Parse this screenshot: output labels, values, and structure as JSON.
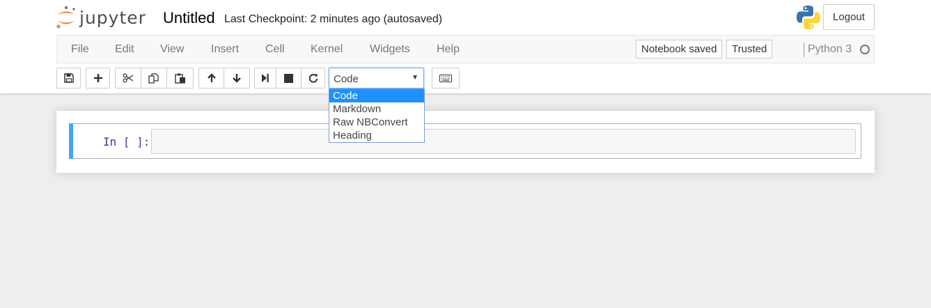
{
  "header": {
    "logo_text": "jupyter",
    "notebook_name": "Untitled",
    "checkpoint": "Last Checkpoint: 2 minutes ago (autosaved)",
    "logout_label": "Logout"
  },
  "menubar": {
    "items": [
      "File",
      "Edit",
      "View",
      "Insert",
      "Cell",
      "Kernel",
      "Widgets",
      "Help"
    ],
    "notification": "Notebook saved",
    "trusted": "Trusted",
    "kernel_name": "Python 3"
  },
  "toolbar": {
    "buttons": [
      "save-icon",
      "plus-icon",
      "cut-icon",
      "copy-icon",
      "paste-icon",
      "arrow-up-icon",
      "arrow-down-icon",
      "run-icon",
      "stop-icon",
      "restart-icon",
      "keyboard-icon"
    ],
    "cell_type": {
      "selected": "Code",
      "options": [
        "Code",
        "Markdown",
        "Raw NBConvert",
        "Heading"
      ]
    }
  },
  "cell": {
    "prompt": "In [ ]:"
  },
  "colors": {
    "selected_cell_bar": "#42a5f5",
    "dropdown_highlight": "#1e90ff",
    "logo_orange": "#f37726"
  }
}
